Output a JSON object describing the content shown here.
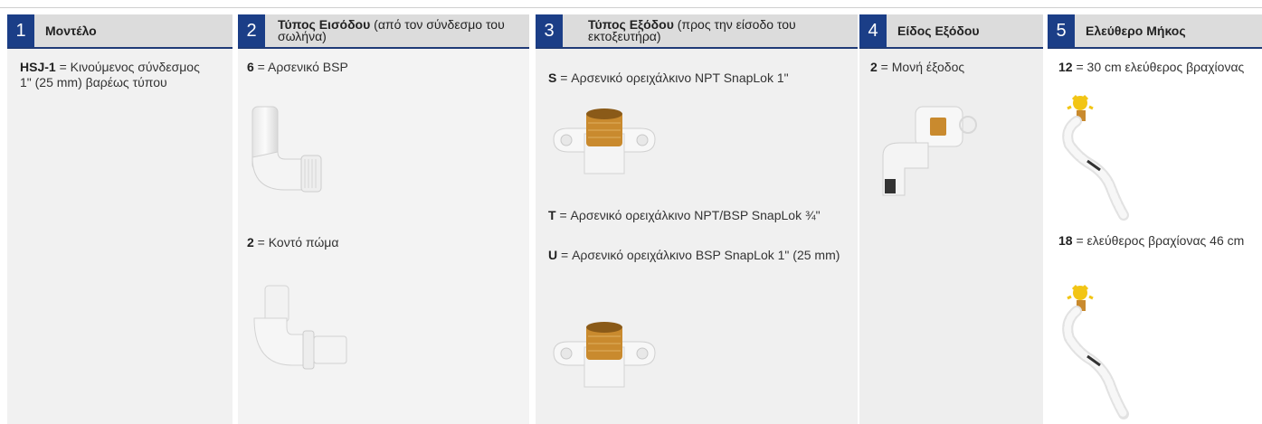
{
  "columns": [
    {
      "number": "1",
      "title_bold": "Μοντέλο",
      "title_rest": "",
      "items": [
        {
          "code": "HSJ-1",
          "text": " = Κινούμενος σύνδεσμος 1\" (25 mm) βαρέως τύπου"
        }
      ]
    },
    {
      "number": "2",
      "title_bold": "Τύπος Εισόδου",
      "title_rest": " (από τον σύνδεσμο του σωλήνα)",
      "items": [
        {
          "code": "6",
          "text": " = Αρσενικό BSP"
        },
        {
          "code": "2",
          "text": "  = Κοντό πώμα"
        }
      ]
    },
    {
      "number": "3",
      "title_bold": "Τύπος Εξόδου",
      "title_rest": " (προς την είσοδο του εκτοξευτήρα)",
      "items": [
        {
          "code": "S",
          "text": "  = Αρσενικό ορειχάλκινο NPT SnapLok 1\""
        },
        {
          "code": "T",
          "text": "  = Αρσενικό ορειχάλκινο NPT/BSP SnapLok ¾\""
        },
        {
          "code": "U",
          "text": "  = Αρσενικό ορειχάλκινο BSP SnapLok 1\" (25 mm)"
        }
      ]
    },
    {
      "number": "4",
      "title_bold": "Είδος Εξόδου",
      "title_rest": "",
      "items": [
        {
          "code": "2",
          "text": "  = Μονή έξοδος"
        }
      ]
    },
    {
      "number": "5",
      "title_bold": "Ελεύθερο Μήκος",
      "title_rest": "",
      "items": [
        {
          "code": "12",
          "text": "  = 30 cm ελεύθερος βραχίονας"
        },
        {
          "code": "18",
          "text": "  = ελεύθερος βραχίονας 46 cm"
        }
      ]
    }
  ],
  "colors": {
    "number_badge": "#1b3e87",
    "header_bg": "#dcdcdc",
    "brass": "#c98a2e",
    "fitting_white": "#f6f6f6",
    "yellow_head": "#f2c515"
  },
  "images": [
    "pvc-elbow-male-bsp-image",
    "pvc-elbow-short-spigot-image",
    "brass-snaplok-outlet-image",
    "brass-snaplok-outlet-image",
    "single-outlet-elbow-image",
    "swing-arm-30cm-image",
    "swing-arm-46cm-image"
  ]
}
